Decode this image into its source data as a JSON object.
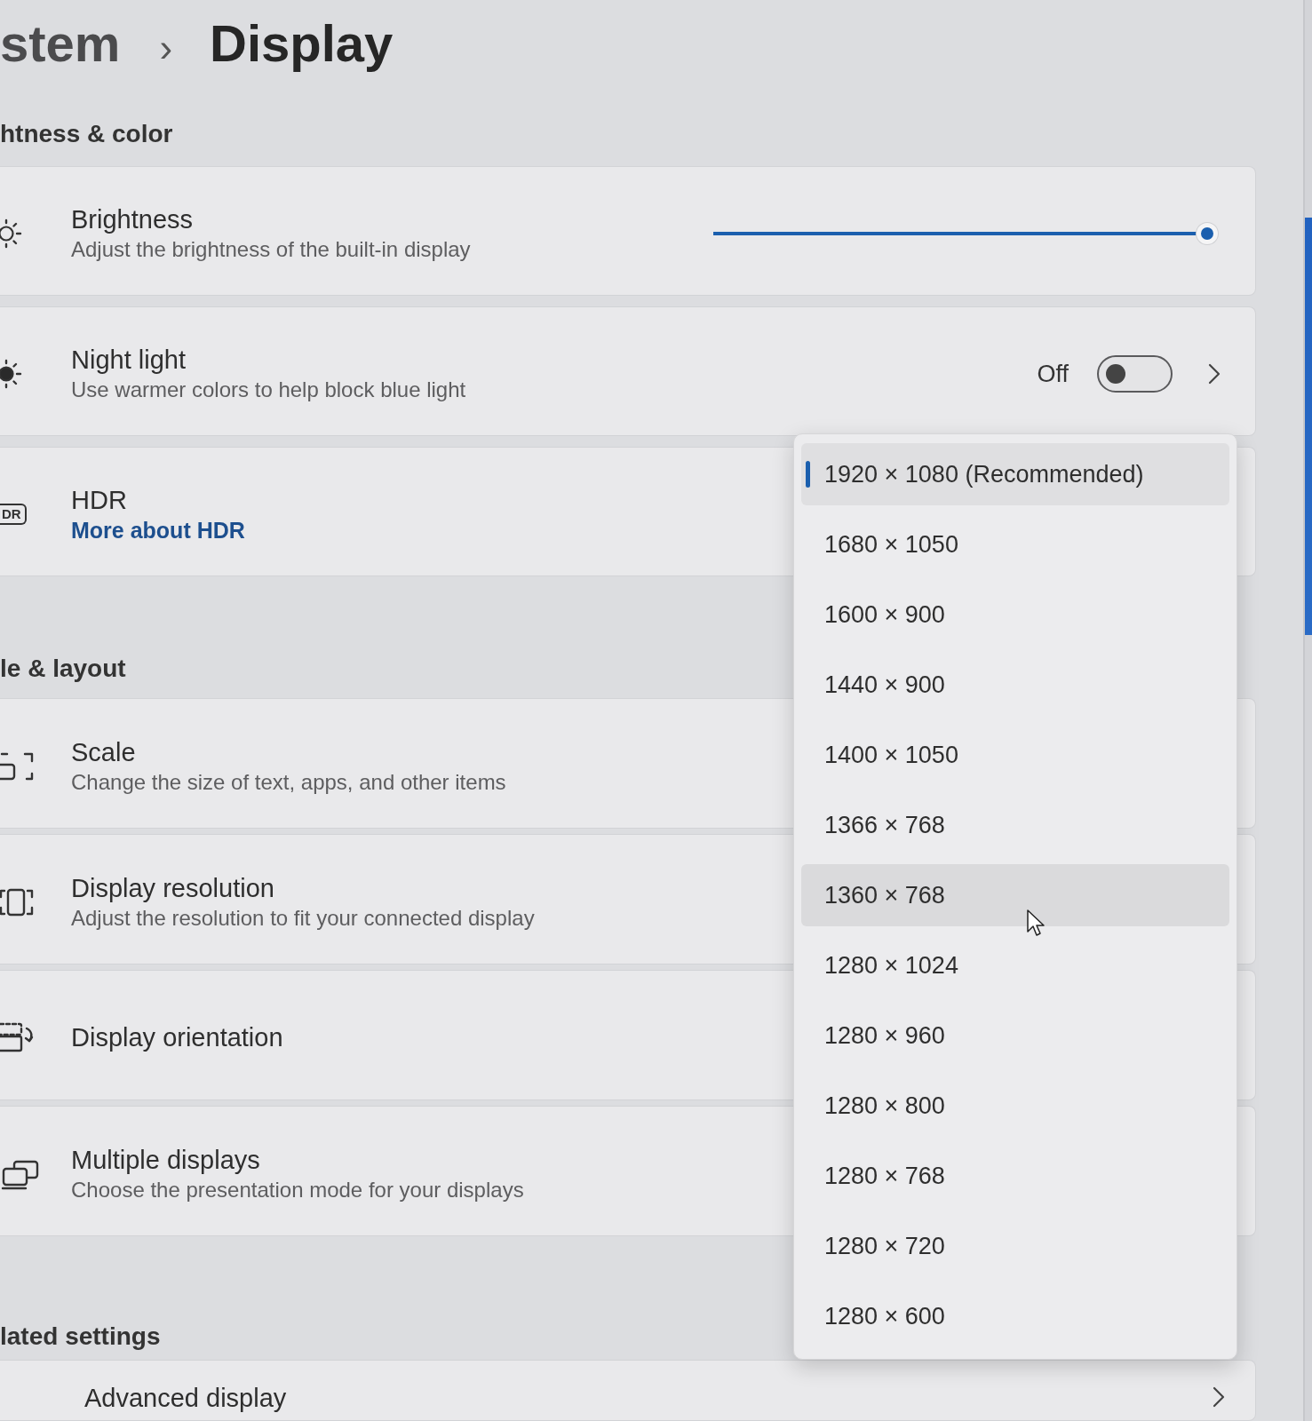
{
  "breadcrumb": {
    "parent": "stem",
    "separator": "›",
    "current": "Display"
  },
  "sections": [
    {
      "title": "htness & color",
      "cards": [
        {
          "kind": "slider",
          "title": "Brightness",
          "description": "Adjust the brightness of the built-in display",
          "level": 1
        },
        {
          "kind": "toggle",
          "title": "Night light",
          "description": "Use warmer colors to help block blue light",
          "state_label": "Off",
          "on": false
        },
        {
          "kind": "link",
          "icon_label": "DR",
          "title": "HDR",
          "link": "More about HDR"
        }
      ]
    },
    {
      "title": "le & layout",
      "cards": [
        {
          "kind": "plain",
          "title": "Scale",
          "description": "Change the size of text, apps, and other items"
        },
        {
          "kind": "plain",
          "title": "Display resolution",
          "description": "Adjust the resolution to fit your connected display"
        },
        {
          "kind": "plain",
          "title": "Display orientation"
        },
        {
          "kind": "plain",
          "title": "Multiple displays",
          "description": "Choose the presentation mode for your displays"
        }
      ]
    },
    {
      "title": "lated settings",
      "cards": [
        {
          "kind": "nav",
          "title": "Advanced display"
        }
      ]
    }
  ],
  "resolution_menu": {
    "options": [
      {
        "label": "1920 × 1080 (Recommended)",
        "selected": true,
        "hovered": false
      },
      {
        "label": "1680 × 1050",
        "selected": false,
        "hovered": false
      },
      {
        "label": "1600 × 900",
        "selected": false,
        "hovered": false
      },
      {
        "label": "1440 × 900",
        "selected": false,
        "hovered": false
      },
      {
        "label": "1400 × 1050",
        "selected": false,
        "hovered": false
      },
      {
        "label": "1366 × 768",
        "selected": false,
        "hovered": false
      },
      {
        "label": "1360 × 768",
        "selected": false,
        "hovered": true
      },
      {
        "label": "1280 × 1024",
        "selected": false,
        "hovered": false
      },
      {
        "label": "1280 × 960",
        "selected": false,
        "hovered": false
      },
      {
        "label": "1280 × 800",
        "selected": false,
        "hovered": false
      },
      {
        "label": "1280 × 768",
        "selected": false,
        "hovered": false
      },
      {
        "label": "1280 × 720",
        "selected": false,
        "hovered": false
      },
      {
        "label": "1280 × 600",
        "selected": false,
        "hovered": false
      }
    ]
  }
}
